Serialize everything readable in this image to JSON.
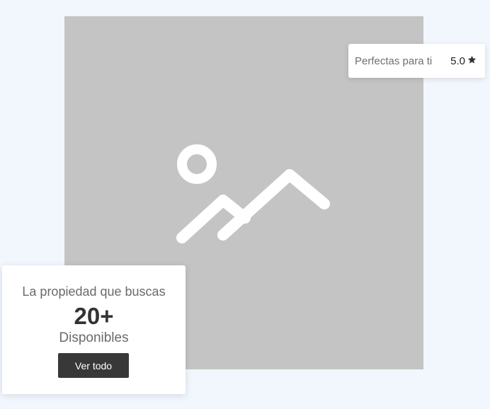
{
  "hero": {
    "placeholder_icon": "image-placeholder-icon"
  },
  "rating_card": {
    "label": "Perfectas para ti",
    "value": "5.0",
    "icon": "star-icon"
  },
  "promo_card": {
    "heading": "La propiedad que buscas",
    "count": "20+",
    "subheading": "Disponibles",
    "button_label": "Ver todo"
  },
  "colors": {
    "page_background": "#f2f6fd",
    "image_placeholder": "#c4c4c4",
    "button_background": "#383838"
  }
}
